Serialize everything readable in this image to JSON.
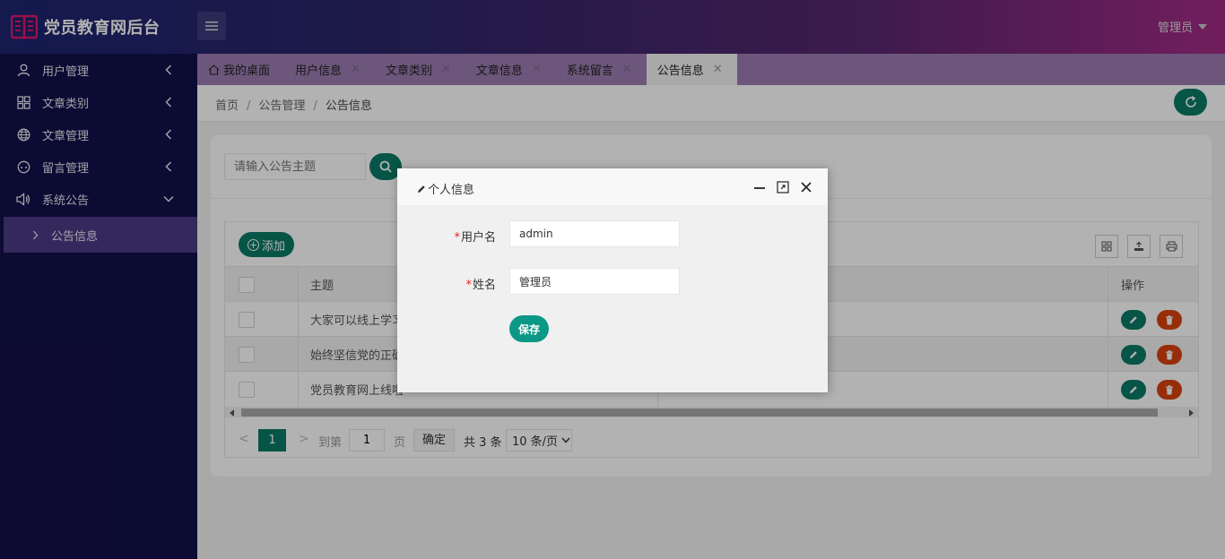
{
  "header": {
    "title": "党员教育网后台",
    "user": "管理员"
  },
  "sidebar": {
    "items": [
      {
        "label": "用户管理",
        "icon": "user-icon"
      },
      {
        "label": "文章类别",
        "icon": "grid-icon"
      },
      {
        "label": "文章管理",
        "icon": "globe-icon"
      },
      {
        "label": "留言管理",
        "icon": "message-icon"
      },
      {
        "label": "系统公告",
        "icon": "speaker-icon"
      }
    ],
    "sub_item": "公告信息"
  },
  "tabs": [
    {
      "label": "我的桌面"
    },
    {
      "label": "用户信息"
    },
    {
      "label": "文章类别"
    },
    {
      "label": "文章信息"
    },
    {
      "label": "系统留言"
    },
    {
      "label": "公告信息"
    }
  ],
  "breadcrumb": [
    "首页",
    "公告管理",
    "公告信息"
  ],
  "search": {
    "placeholder": "请输入公告主题"
  },
  "toolbar": {
    "add_label": "添加"
  },
  "table": {
    "headers": {
      "subject": "主题",
      "actions": "操作"
    },
    "rows": [
      {
        "subject": "大家可以线上学习"
      },
      {
        "subject": "始终坚信党的正确"
      },
      {
        "subject": "党员教育网上线啦"
      }
    ]
  },
  "pager": {
    "current": "1",
    "goto_label": "到第",
    "page_value": "1",
    "page_unit": "页",
    "confirm": "确定",
    "total": "共 3 条",
    "page_size": "10 条/页"
  },
  "modal": {
    "title": "个人信息",
    "fields": [
      {
        "label": "用户名",
        "value": "admin"
      },
      {
        "label": "姓名",
        "value": "管理员"
      }
    ],
    "save_label": "保存",
    "required_mark": "*"
  },
  "colors": {
    "primary": "#0b7a66",
    "danger": "#d9420e",
    "sidebar": "#12104a",
    "sidebar_active": "#4b3a86"
  }
}
